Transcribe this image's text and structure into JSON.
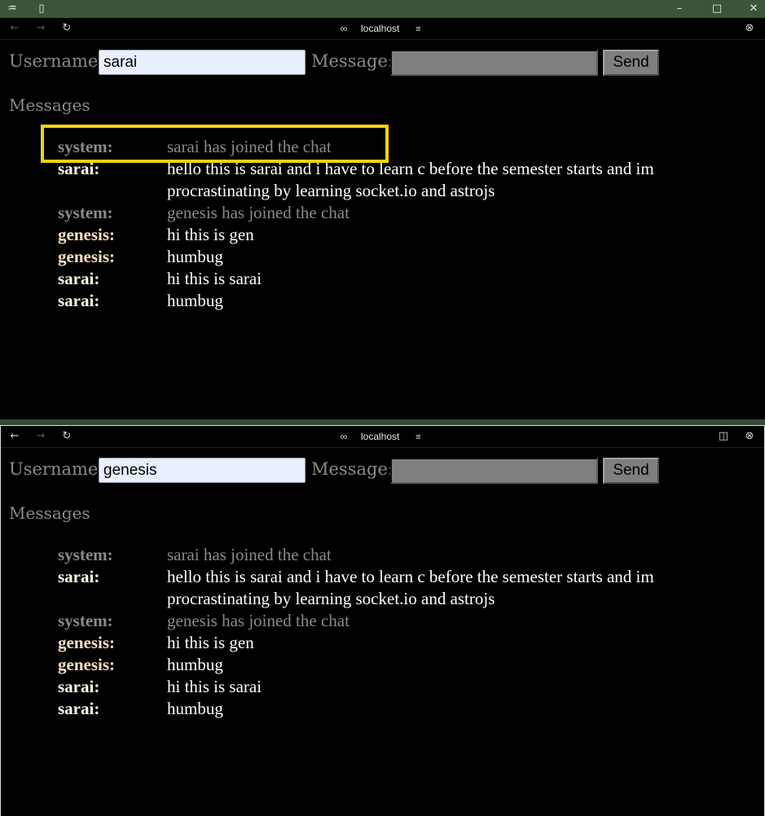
{
  "browser": {
    "url_host": "localhost"
  },
  "top_window": {
    "form": {
      "username_label": "Username:",
      "username_value": "sarai",
      "message_label": "Message:",
      "message_value": "",
      "send_label": "Send"
    },
    "messages_heading": "Messages",
    "messages": [
      {
        "sender": "system:",
        "text": "sarai has joined the chat",
        "kind": "system"
      },
      {
        "sender": "sarai:",
        "text": "hello this is sarai and i have to learn c before the semester starts and im procrastinating by learning socket.io and astrojs",
        "kind": "sarai"
      },
      {
        "sender": "system:",
        "text": "genesis has joined the chat",
        "kind": "system"
      },
      {
        "sender": "genesis:",
        "text": "hi this is gen",
        "kind": "genesis"
      },
      {
        "sender": "genesis:",
        "text": "humbug",
        "kind": "genesis"
      },
      {
        "sender": "sarai:",
        "text": "hi this is sarai",
        "kind": "sarai"
      },
      {
        "sender": "sarai:",
        "text": "humbug",
        "kind": "sarai"
      }
    ]
  },
  "bottom_window": {
    "form": {
      "username_label": "Username:",
      "username_value": "genesis",
      "message_label": "Message:",
      "message_value": "",
      "send_label": "Send"
    },
    "messages_heading": "Messages",
    "messages": [
      {
        "sender": "system:",
        "text": "sarai has joined the chat",
        "kind": "system"
      },
      {
        "sender": "sarai:",
        "text": "hello this is sarai and i have to learn c before the semester starts and im procrastinating by learning socket.io and astrojs",
        "kind": "sarai"
      },
      {
        "sender": "system:",
        "text": "genesis has joined the chat",
        "kind": "system"
      },
      {
        "sender": "genesis:",
        "text": "hi this is gen",
        "kind": "genesis"
      },
      {
        "sender": "genesis:",
        "text": "humbug",
        "kind": "genesis"
      },
      {
        "sender": "sarai:",
        "text": "hi this is sarai",
        "kind": "sarai"
      },
      {
        "sender": "sarai:",
        "text": "humbug",
        "kind": "sarai"
      }
    ]
  },
  "colors": {
    "titlebar": "#3a5638",
    "highlight": "#f2d20a",
    "system_text": "#8a8a8a",
    "input_bg": "#e8f0fe"
  },
  "icons": [
    "app-logo-icon",
    "sidebar-toggle-icon",
    "minimize-icon",
    "maximize-icon",
    "close-icon",
    "back-arrow-icon",
    "forward-arrow-icon",
    "reload-icon",
    "link-icon",
    "site-settings-icon",
    "split-view-icon",
    "close-tab-icon"
  ]
}
